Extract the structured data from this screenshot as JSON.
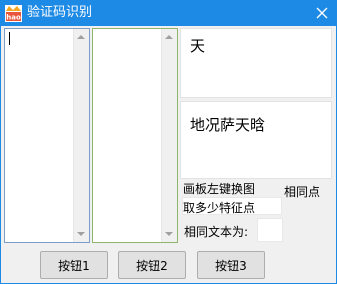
{
  "window": {
    "title": "验证码识别",
    "title_bar_color": "#1d8ae5",
    "app_icon": "hao-app-icon",
    "close_icon": "close-icon"
  },
  "panels": {
    "top_text": "天",
    "middle_text": "地况萨天晗"
  },
  "labels": {
    "draw_board": "画板左键换图",
    "same_points": "相同点",
    "feature_points": "取多少特征点",
    "same_text": "相同文本为:"
  },
  "buttons": {
    "button1": "按钮1",
    "button2": "按钮2",
    "button3": "按钮3"
  }
}
